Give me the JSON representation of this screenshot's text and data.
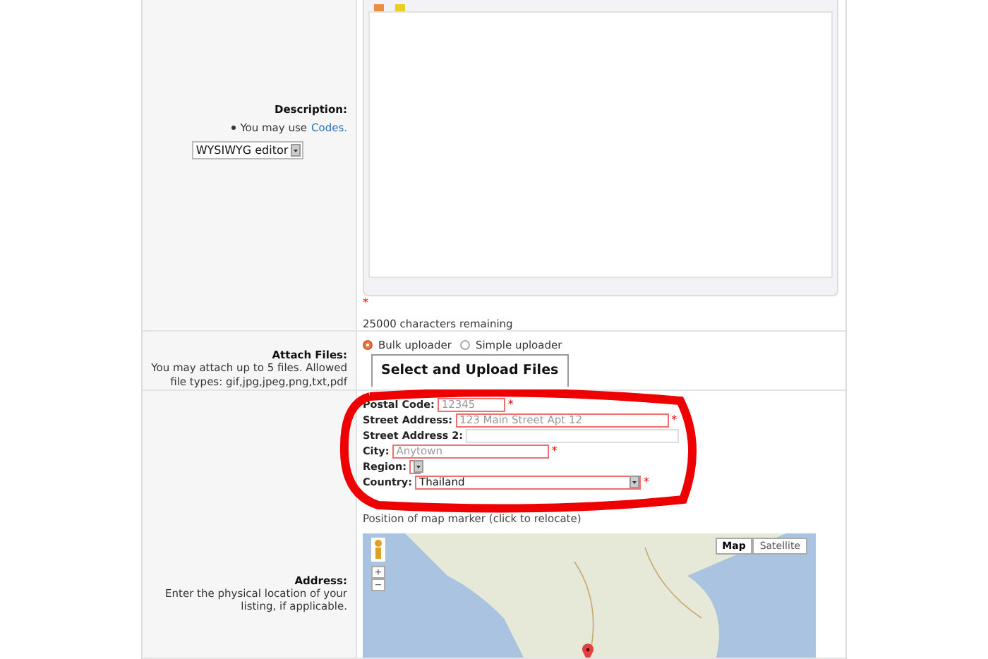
{
  "description": {
    "label": "Description:",
    "hint_before": "You may use",
    "hint_link": "Codes.",
    "editor_select": "WYSIWYG editor",
    "required_mark": "*",
    "chars_remaining": "25000 characters remaining"
  },
  "attach": {
    "label": "Attach Files:",
    "hint": "You may attach up to 5 files. Allowed file types: gif,jpg,jpeg,png,txt,pdf",
    "uploaders": [
      {
        "label": "Bulk uploader",
        "selected": true
      },
      {
        "label": "Simple uploader",
        "selected": false
      }
    ],
    "upload_button": "Select and Upload Files"
  },
  "address": {
    "label": "Address:",
    "hint": "Enter the physical location of your listing, if applicable.",
    "fields": [
      {
        "kind": "text",
        "label": "Postal Code:",
        "placeholder": "12345",
        "required": true
      },
      {
        "kind": "text",
        "label": "Street Address:",
        "placeholder": "123 Main Street Apt 12",
        "required": true
      },
      {
        "kind": "text",
        "label": "Street Address 2:",
        "required": false
      },
      {
        "kind": "text",
        "label": "City:",
        "placeholder": "Anytown",
        "required": true
      },
      {
        "kind": "select",
        "label": "Region:",
        "required": false
      },
      {
        "kind": "select",
        "label": "Country:",
        "value": "Thailand",
        "required": true
      }
    ],
    "required_mark": "*",
    "map_caption": "Position of map marker (click to relocate)",
    "map_types": [
      {
        "label": "Map",
        "selected": true
      },
      {
        "label": "Satellite",
        "selected": false
      }
    ],
    "zoom_in": "+",
    "zoom_out": "−"
  }
}
